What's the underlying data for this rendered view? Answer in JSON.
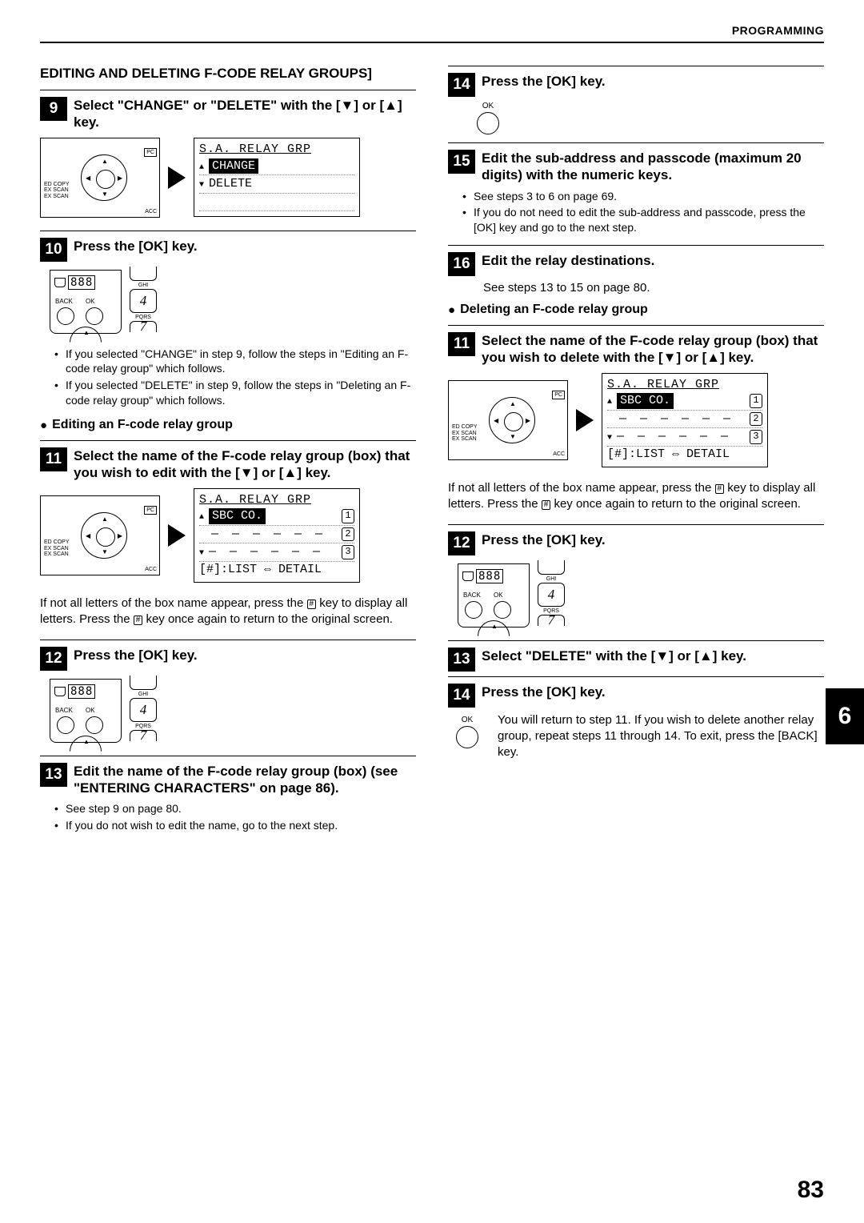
{
  "chapter_header": "PROGRAMMING",
  "section_title": "EDITING AND DELETING F-CODE RELAY GROUPS]",
  "left": {
    "step9": {
      "num": "9",
      "text": "Select \"CHANGE\" or \"DELETE\" with the [▼] or [▲] key."
    },
    "lcd9": {
      "title": "S.A. RELAY GRP",
      "opt1": "CHANGE",
      "opt2": "DELETE"
    },
    "panel_labels": {
      "l1": "ED COPY",
      "l2": "EX SCAN",
      "l3": "EX SCAN",
      "pc": "PC",
      "acc": "ACC"
    },
    "step10": {
      "num": "10",
      "text": "Press the [OK] key."
    },
    "ok_panel": {
      "digits": "888",
      "back": "BACK",
      "ok": "OK",
      "ghi": "GHI",
      "k4": "4",
      "pqrs": "PQRS",
      "k7": "7"
    },
    "bullets10": [
      "If you selected \"CHANGE\" in step 9, follow the steps in \"Editing an F-code relay group\" which follows.",
      "If you selected \"DELETE\" in step 9, follow the steps in \"Deleting an F-code relay group\" which follows."
    ],
    "heading_edit": "Editing an F-code relay group",
    "step11": {
      "num": "11",
      "text": "Select the name of the F-code relay group (box) that you wish to edit with the [▼] or [▲] key."
    },
    "lcd11": {
      "title": "S.A. RELAY GRP",
      "row1": "SBC CO.",
      "dashes": "― ― ― ― ― ―",
      "footer": "[#]:LIST ⇔ DETAIL"
    },
    "note11_a": "If not all letters of the box name appear, press the ",
    "note11_b": " key to display all letters. Press the ",
    "note11_c": " key once again to return to the original screen.",
    "step12": {
      "num": "12",
      "text": "Press the [OK] key."
    },
    "step13": {
      "num": "13",
      "text": "Edit the name of the F-code relay group (box) (see \"ENTERING CHARACTERS\" on page 86)."
    },
    "bullets13": [
      "See step 9 on page 80.",
      "If you do not wish to edit the name, go to the next step."
    ]
  },
  "right": {
    "step14": {
      "num": "14",
      "text": "Press the [OK] key."
    },
    "ok_label": "OK",
    "step15": {
      "num": "15",
      "text": "Edit the sub-address and passcode (maximum 20 digits) with the numeric keys."
    },
    "bullets15": [
      "See steps 3 to 6 on page 69.",
      "If you do not need to edit the sub-address and passcode, press the [OK] key and go to the next step."
    ],
    "step16": {
      "num": "16",
      "text": "Edit the relay destinations."
    },
    "note16": "See steps 13 to 15 on page 80.",
    "heading_del": "Deleting an F-code relay group",
    "step11d": {
      "num": "11",
      "text": "Select the name of the F-code relay group (box) that you wish to delete with the [▼] or [▲] key."
    },
    "lcd11d": {
      "title": "S.A. RELAY GRP",
      "row1": "SBC CO.",
      "dashes": "― ― ― ― ― ―",
      "footer": "[#]:LIST ⇔ DETAIL"
    },
    "note11d_a": "If not all letters of the box name appear, press the ",
    "note11d_b": " key to display all letters. Press the ",
    "note11d_c": " key once again to return to the original screen.",
    "step12d": {
      "num": "12",
      "text": "Press the [OK] key."
    },
    "step13d": {
      "num": "13",
      "text": "Select \"DELETE\" with the [▼] or [▲] key."
    },
    "step14d": {
      "num": "14",
      "text": "Press the [OK] key."
    },
    "final_text": "You will return to step 11. If you wish to delete another relay group, repeat steps 11 through 14. To exit, press the [BACK] key."
  },
  "page_number": "83",
  "side_tab": "6",
  "hash_char": "#"
}
